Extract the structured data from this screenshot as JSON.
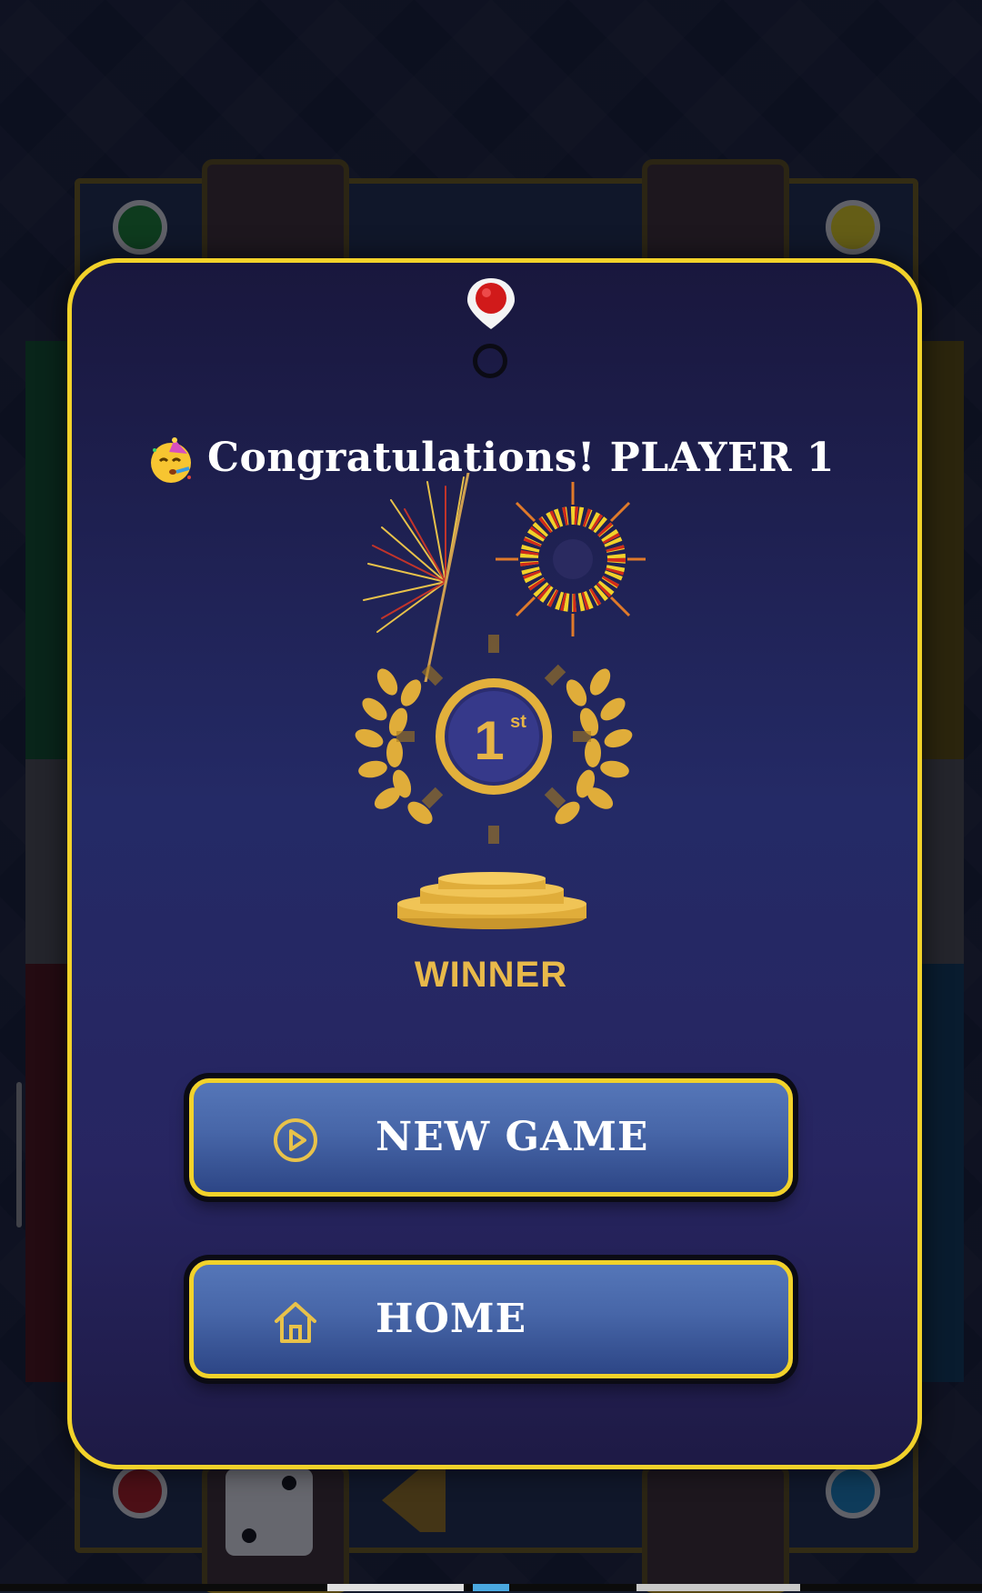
{
  "title": {
    "emoji_icon": "partying-face-icon",
    "text": "Congratulations! PLAYER 1"
  },
  "rank": {
    "number": "1",
    "suffix": "st"
  },
  "winner_label": "WINNER",
  "buttons": {
    "new_game": {
      "label": "NEW GAME",
      "icon": "play-circle-icon"
    },
    "home": {
      "label": "HOME",
      "icon": "home-icon"
    }
  },
  "player_colors": {
    "winner_pin": "#d11a1a",
    "accent_gold": "#f2d22a",
    "button_blue": "#4766a8"
  }
}
